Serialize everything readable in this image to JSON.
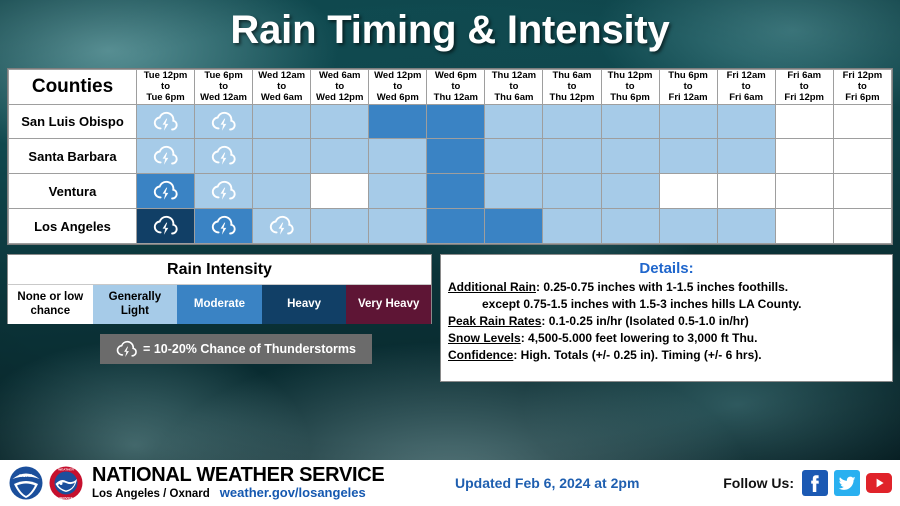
{
  "title": "Rain Timing & Intensity",
  "table": {
    "counties_header": "Counties",
    "time_columns": [
      {
        "line1": "Tue 12pm",
        "line2": "to",
        "line3": "Tue 6pm"
      },
      {
        "line1": "Tue 6pm",
        "line2": "to",
        "line3": "Wed 12am"
      },
      {
        "line1": "Wed 12am",
        "line2": "to",
        "line3": "Wed 6am"
      },
      {
        "line1": "Wed 6am",
        "line2": "to",
        "line3": "Wed 12pm"
      },
      {
        "line1": "Wed 12pm",
        "line2": "to",
        "line3": "Wed 6pm"
      },
      {
        "line1": "Wed 6pm",
        "line2": "to",
        "line3": "Thu 12am"
      },
      {
        "line1": "Thu 12am",
        "line2": "to",
        "line3": "Thu 6am"
      },
      {
        "line1": "Thu 6am",
        "line2": "to",
        "line3": "Thu 12pm"
      },
      {
        "line1": "Thu 12pm",
        "line2": "to",
        "line3": "Thu 6pm"
      },
      {
        "line1": "Thu 6pm",
        "line2": "to",
        "line3": "Fri 12am"
      },
      {
        "line1": "Fri 12am",
        "line2": "to",
        "line3": "Fri 6am"
      },
      {
        "line1": "Fri 6am",
        "line2": "to",
        "line3": "Fri 12pm"
      },
      {
        "line1": "Fri 12pm",
        "line2": "to",
        "line3": "Fri 6pm"
      }
    ],
    "rows": [
      {
        "county": "San Luis Obispo",
        "cells": [
          {
            "intensity": "light",
            "storm": true
          },
          {
            "intensity": "light",
            "storm": true
          },
          {
            "intensity": "light",
            "storm": false
          },
          {
            "intensity": "light",
            "storm": false
          },
          {
            "intensity": "moderate",
            "storm": false
          },
          {
            "intensity": "moderate",
            "storm": false
          },
          {
            "intensity": "light",
            "storm": false
          },
          {
            "intensity": "light",
            "storm": false
          },
          {
            "intensity": "light",
            "storm": false
          },
          {
            "intensity": "light",
            "storm": false
          },
          {
            "intensity": "light",
            "storm": false
          },
          {
            "intensity": "none",
            "storm": false
          },
          {
            "intensity": "none",
            "storm": false
          }
        ]
      },
      {
        "county": "Santa Barbara",
        "cells": [
          {
            "intensity": "light",
            "storm": true
          },
          {
            "intensity": "light",
            "storm": true
          },
          {
            "intensity": "light",
            "storm": false
          },
          {
            "intensity": "light",
            "storm": false
          },
          {
            "intensity": "light",
            "storm": false
          },
          {
            "intensity": "moderate",
            "storm": false
          },
          {
            "intensity": "light",
            "storm": false
          },
          {
            "intensity": "light",
            "storm": false
          },
          {
            "intensity": "light",
            "storm": false
          },
          {
            "intensity": "light",
            "storm": false
          },
          {
            "intensity": "light",
            "storm": false
          },
          {
            "intensity": "none",
            "storm": false
          },
          {
            "intensity": "none",
            "storm": false
          }
        ]
      },
      {
        "county": "Ventura",
        "cells": [
          {
            "intensity": "moderate",
            "storm": true
          },
          {
            "intensity": "light",
            "storm": true
          },
          {
            "intensity": "light",
            "storm": false
          },
          {
            "intensity": "none",
            "storm": false
          },
          {
            "intensity": "light",
            "storm": false
          },
          {
            "intensity": "moderate",
            "storm": false
          },
          {
            "intensity": "light",
            "storm": false
          },
          {
            "intensity": "light",
            "storm": false
          },
          {
            "intensity": "light",
            "storm": false
          },
          {
            "intensity": "none",
            "storm": false
          },
          {
            "intensity": "none",
            "storm": false
          },
          {
            "intensity": "none",
            "storm": false
          },
          {
            "intensity": "none",
            "storm": false
          }
        ]
      },
      {
        "county": "Los Angeles",
        "cells": [
          {
            "intensity": "heavy",
            "storm": true
          },
          {
            "intensity": "moderate",
            "storm": true
          },
          {
            "intensity": "light",
            "storm": true
          },
          {
            "intensity": "light",
            "storm": false
          },
          {
            "intensity": "light",
            "storm": false
          },
          {
            "intensity": "moderate",
            "storm": false
          },
          {
            "intensity": "moderate",
            "storm": false
          },
          {
            "intensity": "light",
            "storm": false
          },
          {
            "intensity": "light",
            "storm": false
          },
          {
            "intensity": "light",
            "storm": false
          },
          {
            "intensity": "light",
            "storm": false
          },
          {
            "intensity": "none",
            "storm": false
          },
          {
            "intensity": "none",
            "storm": false
          }
        ]
      }
    ]
  },
  "legend": {
    "title": "Rain Intensity",
    "swatches": [
      {
        "label": "None or low chance",
        "color": "#ffffff",
        "text": "dark"
      },
      {
        "label": "Generally Light",
        "color": "#a6cbe8",
        "text": "dark"
      },
      {
        "label": "Moderate",
        "color": "#3a83c4",
        "text": "light"
      },
      {
        "label": "Heavy",
        "color": "#113f66",
        "text": "light"
      },
      {
        "label": "Very Heavy",
        "color": "#5e1535",
        "text": "light"
      }
    ],
    "thunder_note": "=  10-20% Chance of Thunderstorms"
  },
  "details": {
    "title": "Details:",
    "lines": [
      {
        "label": "Additional Rain",
        "text": ": 0.25-0.75 inches with 1-1.5 inches foothills.",
        "indent": false
      },
      {
        "label": "",
        "text": "except 0.75-1.5 inches with 1.5-3 inches hills LA County.",
        "indent": true
      },
      {
        "label": "Peak Rain Rates",
        "text": ": 0.1-0.25 in/hr (Isolated 0.5-1.0 in/hr)",
        "indent": false
      },
      {
        "label": "Snow Levels",
        "text": ": 4,500-5.000 feet lowering to 3,000 ft Thu.",
        "indent": false
      },
      {
        "label": "Confidence",
        "text": ": High. Totals (+/- 0.25 in). Timing (+/- 6 hrs).",
        "indent": false
      }
    ]
  },
  "footer": {
    "agency": "NATIONAL WEATHER SERVICE",
    "office": "Los Angeles / Oxnard",
    "url": "weather.gov/losangeles",
    "updated": "Updated Feb 6, 2024 at 2pm",
    "follow_label": "Follow Us:"
  }
}
